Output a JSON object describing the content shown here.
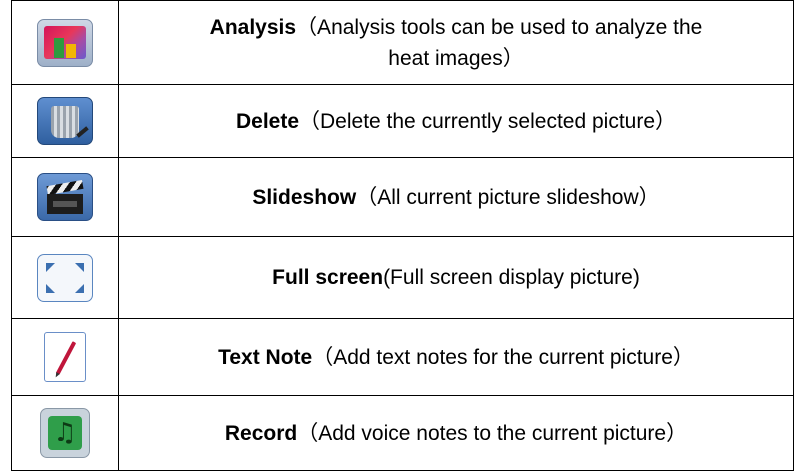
{
  "rows": [
    {
      "term": "Analysis",
      "desc": "（Analysis tools can be used to analyze the",
      "desc2": "heat images）",
      "icon": "analysis-icon"
    },
    {
      "term": "Delete",
      "desc": "（Delete the currently selected picture）",
      "icon": "trash-icon"
    },
    {
      "term": "Slideshow",
      "desc": "（All current picture slideshow）",
      "icon": "clapperboard-icon"
    },
    {
      "term": "Full screen",
      "desc": "(Full screen display picture)",
      "icon": "fullscreen-icon"
    },
    {
      "term": "Text Note",
      "desc": "（Add text notes for the current picture）",
      "icon": "pencil-icon"
    },
    {
      "term": "Record",
      "desc": "（Add voice notes to the current picture）",
      "icon": "music-note-icon"
    }
  ]
}
